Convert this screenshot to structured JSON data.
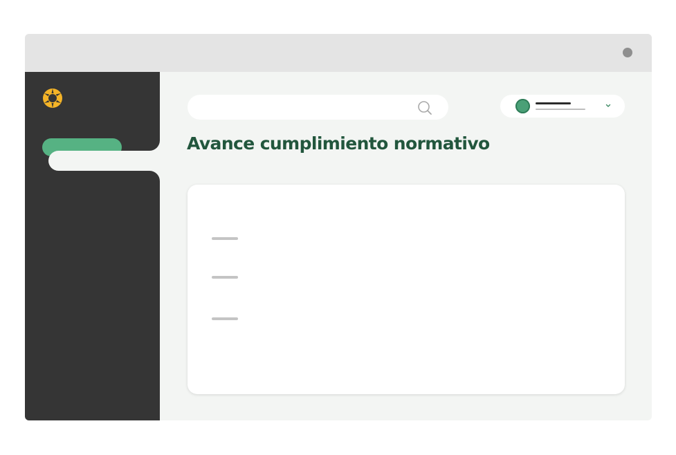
{
  "window": {
    "controls": [
      "window-control"
    ]
  },
  "app": {
    "logo": "gear-logo",
    "accent_color": "#56b283",
    "logo_color": "#f5b427",
    "title_color": "#22563d"
  },
  "sidebar": {
    "items": [
      {
        "state": "highlighted"
      },
      {
        "state": "active-tab"
      }
    ]
  },
  "header": {
    "search": {
      "placeholder": "",
      "value": "",
      "icon": "search-icon"
    },
    "user_menu": {
      "avatar_color": "#4aa077",
      "chevron": "chevron-down-icon"
    }
  },
  "main": {
    "title": "Avance cumplimiento normativo",
    "card": {
      "list_items": [
        "",
        "",
        ""
      ]
    }
  }
}
